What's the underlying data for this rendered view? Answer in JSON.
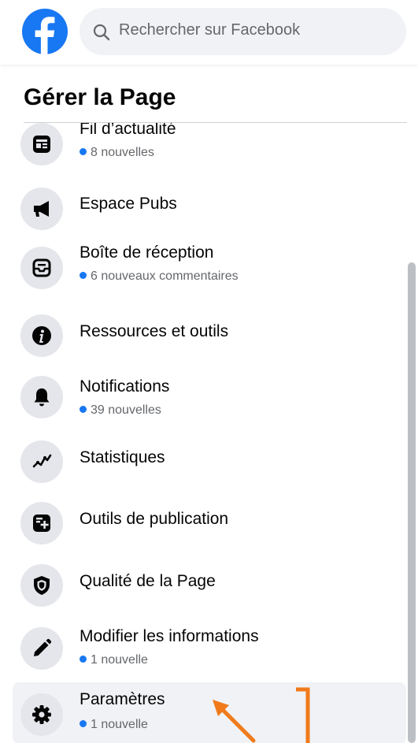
{
  "topbar": {
    "search": {
      "placeholder": "Rechercher sur Facebook"
    }
  },
  "section": {
    "title": "Gérer la Page"
  },
  "menu": {
    "items": [
      {
        "label": "Fil d’actualité",
        "sub": "8 nouvelles",
        "icon": "news-feed-icon"
      },
      {
        "label": "Espace Pubs",
        "sub": "",
        "icon": "megaphone-icon"
      },
      {
        "label": "Boîte de réception",
        "sub": "6 nouveaux commentaires",
        "icon": "inbox-icon"
      },
      {
        "label": "Ressources et outils",
        "sub": "",
        "icon": "info-icon"
      },
      {
        "label": "Notifications",
        "sub": "39 nouvelles",
        "icon": "bell-icon"
      },
      {
        "label": "Statistiques",
        "sub": "",
        "icon": "insights-icon"
      },
      {
        "label": "Outils de publication",
        "sub": "",
        "icon": "publishing-tools-icon"
      },
      {
        "label": "Qualité de la Page",
        "sub": "",
        "icon": "shield-icon"
      },
      {
        "label": "Modifier les informations",
        "sub": "1 nouvelle",
        "icon": "pencil-icon"
      },
      {
        "label": "Paramètres",
        "sub": "1 nouvelle",
        "icon": "gear-icon",
        "selected": true
      }
    ]
  },
  "colors": {
    "brand": "#1877f2",
    "annotation": "#f07a1a",
    "icon_bg": "#e4e6eb",
    "selected_bg": "#f0f2f5"
  }
}
